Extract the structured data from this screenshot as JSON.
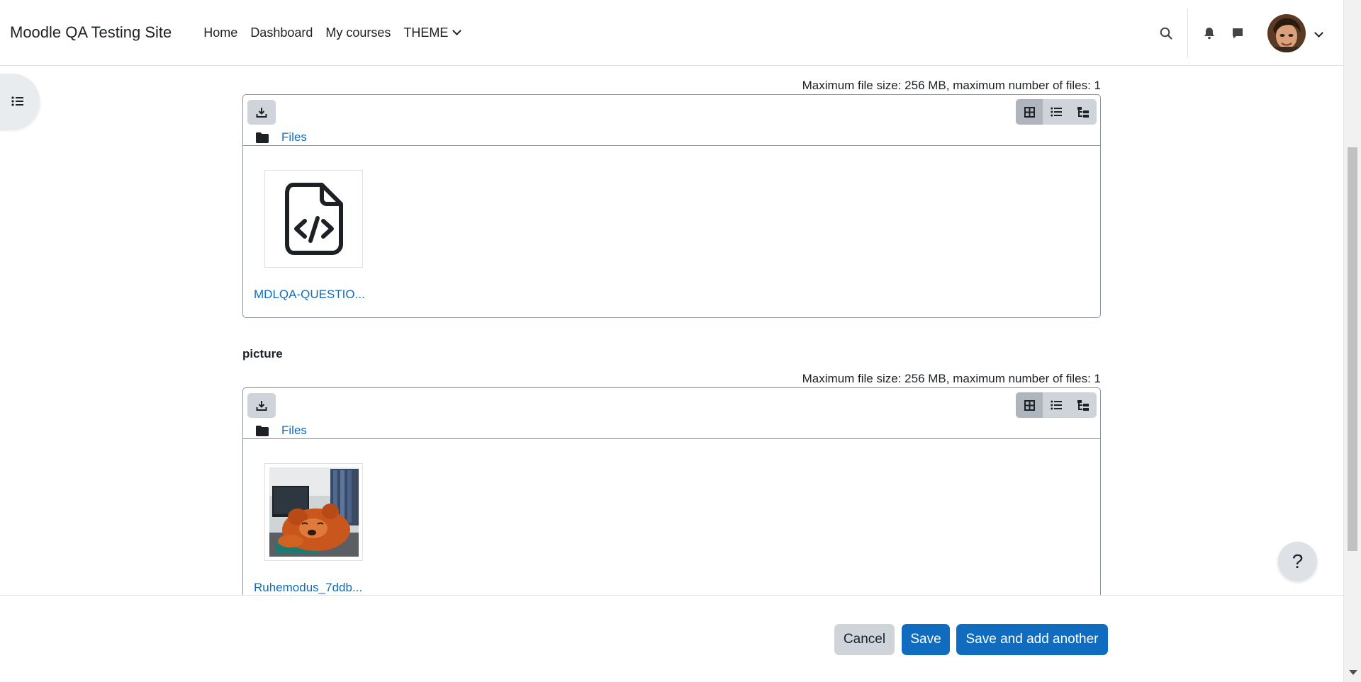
{
  "navbar": {
    "brand": "Moodle QA Testing Site",
    "links": [
      "Home",
      "Dashboard",
      "My courses",
      "THEME"
    ]
  },
  "filemanagers": [
    {
      "max_info": "Maximum file size: 256 MB, maximum number of files: 1",
      "path_label": "Files",
      "file_name": "MDLQA-QUESTIO...",
      "file_icon": "code-file-icon"
    },
    {
      "label": "picture",
      "max_info": "Maximum file size: 256 MB, maximum number of files: 1",
      "path_label": "Files",
      "file_name": "Ruhemodus_7ddb...",
      "file_icon": "image-thumbnail"
    }
  ],
  "footer": {
    "cancel": "Cancel",
    "save": "Save",
    "save_add": "Save and add another"
  },
  "help": "?",
  "colors": {
    "link": "#0f6cbf",
    "primary": "#0f6cbf",
    "secondary": "#ced4da"
  }
}
